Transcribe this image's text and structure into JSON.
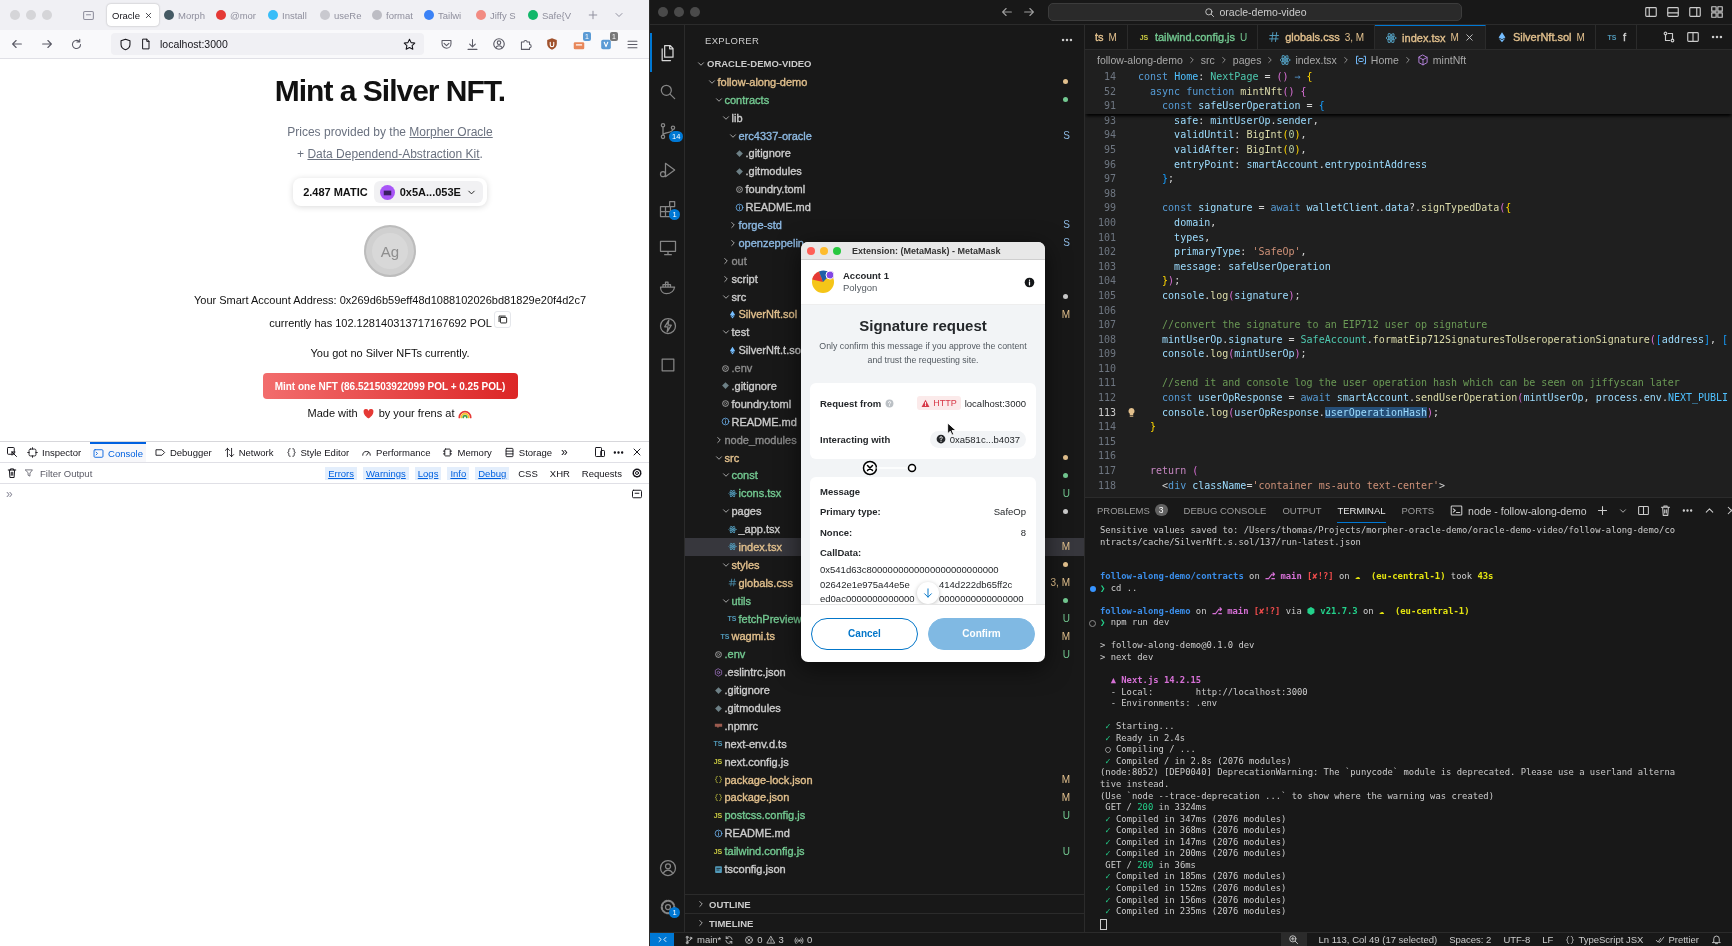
{
  "browser": {
    "tabs": [
      {
        "label": "Oracle",
        "selected": true
      },
      {
        "label": "Morph",
        "selected": false,
        "color": "#455a64"
      },
      {
        "label": "@mor",
        "selected": false,
        "color": "#e53935"
      },
      {
        "label": "Install",
        "selected": false,
        "color": "#38bdf8"
      },
      {
        "label": "useRe",
        "selected": false,
        "color": "#c9c9cf"
      },
      {
        "label": "format",
        "selected": false,
        "color": "#bdbdc4"
      },
      {
        "label": "Tailwi",
        "selected": false,
        "color": "#3b82f6"
      },
      {
        "label": "Jiffy S",
        "selected": false,
        "color": "#f28b82"
      },
      {
        "label": "Safe{V",
        "selected": false,
        "color": "#12b76a"
      }
    ],
    "address": "localhost:3000",
    "extension_badges": [
      "1",
      "1"
    ]
  },
  "page": {
    "title": "Mint a Silver NFT.",
    "credits_line1": {
      "text": "Prices provided by the",
      "link": "Morpher Oracle"
    },
    "credits_line2": {
      "prefix": "+",
      "link": "Data Dependend-Abstraction Kit",
      "suffix": "."
    },
    "wallet": {
      "balance": "2.487 MATIC",
      "account": "0x5A...053E"
    },
    "coin_symbol": "Ag",
    "address_text": "Your Smart Account Address: 0x269d6b59eff48d1088102026bd81829e20f4d2c7",
    "balance_text": "currently has 102.128140313717167692 POL",
    "nft_text": "You got no Silver NFTs currently.",
    "mint_button": "Mint one NFT (86.521503922099 POL + 0.25 POL)",
    "footer": {
      "before": "Made with",
      "after": "by your frens at"
    }
  },
  "devtools": {
    "tabs": [
      {
        "label": "Inspector",
        "kind": "inspector",
        "selected": false
      },
      {
        "label": "Console",
        "kind": "console",
        "selected": true
      },
      {
        "label": "Debugger",
        "kind": "debugger",
        "selected": false
      },
      {
        "label": "Network",
        "kind": "network",
        "selected": false
      },
      {
        "label": "Style Editor",
        "kind": "style",
        "selected": false
      },
      {
        "label": "Performance",
        "kind": "performance",
        "selected": false
      },
      {
        "label": "Memory",
        "kind": "memory",
        "selected": false
      },
      {
        "label": "Storage",
        "kind": "storage",
        "selected": false
      }
    ],
    "overflow": "»",
    "filter_placeholder": "Filter Output",
    "levels": [
      {
        "label": "Errors",
        "on": true
      },
      {
        "label": "Warnings",
        "on": true
      },
      {
        "label": "Logs",
        "on": true
      },
      {
        "label": "Info",
        "on": true
      },
      {
        "label": "Debug",
        "on": true
      },
      {
        "label": "CSS",
        "on": false
      },
      {
        "label": "XHR",
        "on": false
      },
      {
        "label": "Requests",
        "on": false
      }
    ],
    "prompt": "»"
  },
  "titlebar": {
    "search": "oracle-demo-video"
  },
  "activity": {
    "items": [
      {
        "kind": "files",
        "selected": true
      },
      {
        "kind": "search",
        "selected": false
      },
      {
        "kind": "source-control",
        "badge": "14",
        "selected": false
      },
      {
        "kind": "run-debug",
        "selected": false
      },
      {
        "kind": "extensions",
        "badge": "1",
        "selected": false
      },
      {
        "kind": "remote",
        "selected": false
      },
      {
        "kind": "docker",
        "selected": false
      },
      {
        "kind": "bolt",
        "selected": false
      },
      {
        "kind": "square",
        "selected": false
      }
    ],
    "bottom": [
      {
        "kind": "account"
      },
      {
        "kind": "settings",
        "badge": "1"
      }
    ]
  },
  "explorer": {
    "title": "EXPLORER",
    "root": {
      "name": "ORACLE-DEMO-VIDEO",
      "expanded": true
    },
    "tree": [
      {
        "name": "follow-along-demo",
        "kind": "folder",
        "expanded": true,
        "color": "#e2c08d",
        "dot": true,
        "selected": false,
        "children": [
          {
            "name": "contracts",
            "kind": "folder",
            "expanded": true,
            "color": "#73c991",
            "dot": true,
            "selected": false,
            "children": [
              {
                "name": "lib",
                "kind": "folder",
                "expanded": true,
                "color": "#cccccc",
                "dot": false,
                "selected": false,
                "children": [
                  {
                    "name": "erc4337-oracle",
                    "kind": "folder",
                    "expanded": true,
                    "color": "#8db9e2",
                    "dot": false,
                    "status": "S",
                    "selected": false,
                    "children": [
                      {
                        "name": ".gitignore",
                        "kind": "git",
                        "color": "#cccccc",
                        "selected": false
                      },
                      {
                        "name": ".gitmodules",
                        "kind": "git",
                        "color": "#cccccc",
                        "selected": false
                      },
                      {
                        "name": "foundry.toml",
                        "kind": "gear",
                        "color": "#cccccc",
                        "selected": false
                      },
                      {
                        "name": "README.md",
                        "kind": "info",
                        "color": "#cccccc",
                        "selected": false
                      }
                    ]
                  },
                  {
                    "name": "forge-std",
                    "kind": "folder",
                    "expanded": false,
                    "color": "#8db9e2",
                    "dot": false,
                    "status": "S",
                    "selected": false
                  },
                  {
                    "name": "openzeppelin",
                    "kind": "folder",
                    "expanded": false,
                    "color": "#8db9e2",
                    "dot": false,
                    "status": "S",
                    "selected": false
                  }
                ]
              },
              {
                "name": "out",
                "kind": "folder",
                "expanded": false,
                "color": "#8c8c8c",
                "dot": false,
                "selected": false
              },
              {
                "name": "script",
                "kind": "folder",
                "expanded": false,
                "color": "#cccccc",
                "dot": false,
                "selected": false
              },
              {
                "name": "src",
                "kind": "folder",
                "expanded": true,
                "color": "#cccccc",
                "dot": true,
                "selected": false,
                "children": [
                  {
                    "name": "SilverNft.sol",
                    "kind": "eth",
                    "color": "#e2c08d",
                    "status": "M",
                    "selected": false
                  }
                ]
              },
              {
                "name": "test",
                "kind": "folder",
                "expanded": true,
                "color": "#cccccc",
                "dot": false,
                "selected": false,
                "children": [
                  {
                    "name": "SilverNft.t.so",
                    "kind": "eth",
                    "color": "#cccccc",
                    "selected": false
                  }
                ]
              },
              {
                "name": ".env",
                "kind": "gear",
                "color": "#8c8c8c",
                "selected": false
              },
              {
                "name": ".gitignore",
                "kind": "git",
                "color": "#cccccc",
                "selected": false
              },
              {
                "name": "foundry.toml",
                "kind": "gear",
                "color": "#cccccc",
                "selected": false
              },
              {
                "name": "README.md",
                "kind": "info",
                "color": "#cccccc",
                "selected": false
              }
            ]
          },
          {
            "name": "node_modules",
            "kind": "folder",
            "expanded": false,
            "color": "#8c8c8c",
            "dot": false,
            "selected": false
          },
          {
            "name": "src",
            "kind": "folder",
            "expanded": true,
            "color": "#e2c08d",
            "dot": true,
            "selected": false,
            "children": [
              {
                "name": "const",
                "kind": "folder",
                "expanded": true,
                "color": "#73c991",
                "dot": true,
                "selected": false,
                "children": [
                  {
                    "name": "icons.tsx",
                    "kind": "atom",
                    "color": "#73c991",
                    "status": "U",
                    "selected": false
                  }
                ]
              },
              {
                "name": "pages",
                "kind": "folder",
                "expanded": true,
                "color": "#cccccc",
                "dot": true,
                "selected": false,
                "children": [
                  {
                    "name": "_app.tsx",
                    "kind": "atom",
                    "color": "#cccccc",
                    "selected": false
                  },
                  {
                    "name": "index.tsx",
                    "kind": "atom",
                    "color": "#e2c08d",
                    "status": "M",
                    "selected": true
                  }
                ]
              },
              {
                "name": "styles",
                "kind": "folder",
                "expanded": true,
                "color": "#e2c08d",
                "dot": true,
                "selected": false,
                "children": [
                  {
                    "name": "globals.css",
                    "kind": "hash",
                    "color": "#e2c08d",
                    "status": "3, M",
                    "selected": false
                  }
                ]
              },
              {
                "name": "utils",
                "kind": "folder",
                "expanded": true,
                "color": "#73c991",
                "dot": true,
                "selected": false,
                "children": [
                  {
                    "name": "fetchPreview",
                    "kind": "ts",
                    "icon_text": "TS",
                    "color": "#73c991",
                    "status": "U",
                    "selected": false
                  }
                ]
              },
              {
                "name": "wagmi.ts",
                "kind": "ts",
                "icon_text": "TS",
                "color": "#e2c08d",
                "status": "M",
                "selected": false
              }
            ]
          },
          {
            "name": ".env",
            "kind": "gear",
            "color": "#73c991",
            "status": "U",
            "selected": false
          },
          {
            "name": ".eslintrc.json",
            "kind": "eslint",
            "color": "#cccccc",
            "selected": false
          },
          {
            "name": ".gitignore",
            "kind": "git",
            "color": "#cccccc",
            "selected": false
          },
          {
            "name": ".gitmodules",
            "kind": "git",
            "color": "#cccccc",
            "selected": false
          },
          {
            "name": ".npmrc",
            "kind": "npm",
            "color": "#cccccc",
            "selected": false
          },
          {
            "name": "next-env.d.ts",
            "kind": "ts",
            "icon_text": "TS",
            "color": "#cccccc",
            "selected": false
          },
          {
            "name": "next.config.js",
            "kind": "js",
            "icon_text": "JS",
            "color": "#cccccc",
            "selected": false
          },
          {
            "name": "package-lock.json",
            "kind": "braces",
            "color": "#e2c08d",
            "status": "M",
            "selected": false
          },
          {
            "name": "package.json",
            "kind": "braces",
            "color": "#e2c08d",
            "status": "M",
            "selected": false
          },
          {
            "name": "postcss.config.js",
            "kind": "js",
            "icon_text": "JS",
            "color": "#73c991",
            "status": "U",
            "selected": false
          },
          {
            "name": "README.md",
            "kind": "info",
            "color": "#cccccc",
            "selected": false
          },
          {
            "name": "tailwind.config.js",
            "kind": "js",
            "icon_text": "JS",
            "color": "#73c991",
            "status": "U",
            "selected": false
          },
          {
            "name": "tsconfig.json",
            "kind": "tsconfig",
            "color": "#cccccc",
            "selected": false
          }
        ]
      }
    ],
    "sections": [
      {
        "label": "OUTLINE",
        "expanded": false
      },
      {
        "label": "TIMELINE",
        "expanded": false
      }
    ]
  },
  "editor": {
    "tabs": [
      {
        "label": "ts",
        "status": "M",
        "color": "#e2c08d",
        "selected": false
      },
      {
        "label": "tailwind.config.js",
        "status": "U",
        "color": "#73c991",
        "kind": "js",
        "icon_text": "JS",
        "selected": false
      },
      {
        "label": "globals.css",
        "status": "3, M",
        "color": "#e2c08d",
        "kind": "hash",
        "selected": false
      },
      {
        "label": "index.tsx",
        "status": "M",
        "color": "#e2c08d",
        "kind": "atom",
        "selected": true
      },
      {
        "label": "SilverNft.sol",
        "status": "M",
        "color": "#e2c08d",
        "kind": "eth",
        "selected": false
      },
      {
        "label": "f",
        "color": "#cccccc",
        "kind": "ts",
        "icon_text": "TS",
        "selected": false
      }
    ],
    "breadcrumb": [
      {
        "label": "follow-along-demo"
      },
      {
        "label": "src"
      },
      {
        "label": "pages"
      },
      {
        "label": "index.tsx",
        "kind": "atom"
      },
      {
        "label": "Home",
        "kind": "variable"
      },
      {
        "label": "mintNft",
        "kind": "cube"
      }
    ],
    "sticky_lines": [
      {
        "number": "14",
        "current": false,
        "segments": [
          {
            "kind": "kw",
            "text": "const "
          },
          {
            "kind": "const",
            "text": "Home"
          },
          {
            "kind": "pun",
            "text": ": "
          },
          {
            "kind": "type",
            "text": "NextPage"
          },
          {
            "kind": "pun",
            "text": " = "
          },
          {
            "kind": "br2",
            "text": "()"
          },
          {
            "kind": "kw",
            "text": " ⇒ "
          },
          {
            "kind": "br1",
            "text": "{"
          }
        ]
      },
      {
        "number": "52",
        "current": false,
        "segments": [
          {
            "kind": "kw",
            "text": "  async function "
          },
          {
            "kind": "fn",
            "text": "mintNft"
          },
          {
            "kind": "br2",
            "text": "()"
          },
          {
            "kind": "br2",
            "text": " {"
          }
        ]
      },
      {
        "number": "91",
        "current": false,
        "segments": [
          {
            "kind": "kw",
            "text": "    const "
          },
          {
            "kind": "var",
            "text": "safeUserOperation"
          },
          {
            "kind": "pun",
            "text": " = "
          },
          {
            "kind": "br3",
            "text": "{"
          }
        ]
      }
    ],
    "lines": [
      {
        "number": "93",
        "current": false,
        "segments": [
          {
            "kind": "var",
            "text": "      safe"
          },
          {
            "kind": "pun",
            "text": ": "
          },
          {
            "kind": "var",
            "text": "mintUserOp"
          },
          {
            "kind": "pun",
            "text": "."
          },
          {
            "kind": "var",
            "text": "sender"
          },
          {
            "kind": "pun",
            "text": ","
          }
        ]
      },
      {
        "number": "94",
        "current": false,
        "segments": [
          {
            "kind": "var",
            "text": "      validUntil"
          },
          {
            "kind": "pun",
            "text": ": "
          },
          {
            "kind": "fn",
            "text": "BigInt"
          },
          {
            "kind": "br1",
            "text": "("
          },
          {
            "kind": "num",
            "text": "0"
          },
          {
            "kind": "br1",
            "text": ")"
          },
          {
            "kind": "pun",
            "text": ","
          }
        ]
      },
      {
        "number": "95",
        "current": false,
        "segments": [
          {
            "kind": "var",
            "text": "      validAfter"
          },
          {
            "kind": "pun",
            "text": ": "
          },
          {
            "kind": "fn",
            "text": "BigInt"
          },
          {
            "kind": "br1",
            "text": "("
          },
          {
            "kind": "num",
            "text": "0"
          },
          {
            "kind": "br1",
            "text": ")"
          },
          {
            "kind": "pun",
            "text": ","
          }
        ]
      },
      {
        "number": "96",
        "current": false,
        "segments": [
          {
            "kind": "var",
            "text": "      entryPoint"
          },
          {
            "kind": "pun",
            "text": ": "
          },
          {
            "kind": "var",
            "text": "smartAccount"
          },
          {
            "kind": "pun",
            "text": "."
          },
          {
            "kind": "var",
            "text": "entrypointAddress"
          }
        ]
      },
      {
        "number": "97",
        "current": false,
        "segments": [
          {
            "kind": "br3",
            "text": "    }"
          },
          {
            "kind": "pun",
            "text": ";"
          }
        ]
      },
      {
        "number": "98",
        "current": false
      },
      {
        "number": "99",
        "current": false,
        "segments": [
          {
            "kind": "kw",
            "text": "    const "
          },
          {
            "kind": "var",
            "text": "signature"
          },
          {
            "kind": "pun",
            "text": " = "
          },
          {
            "kind": "kw",
            "text": "await "
          },
          {
            "kind": "var",
            "text": "walletClient"
          },
          {
            "kind": "pun",
            "text": "."
          },
          {
            "kind": "var",
            "text": "data"
          },
          {
            "kind": "pun",
            "text": "?."
          },
          {
            "kind": "fn",
            "text": "signTypedData"
          },
          {
            "kind": "br2",
            "text": "("
          },
          {
            "kind": "br1",
            "text": "{"
          }
        ]
      },
      {
        "number": "100",
        "current": false,
        "segments": [
          {
            "kind": "var",
            "text": "      domain"
          },
          {
            "kind": "pun",
            "text": ","
          }
        ]
      },
      {
        "number": "101",
        "current": false,
        "segments": [
          {
            "kind": "var",
            "text": "      types"
          },
          {
            "kind": "pun",
            "text": ","
          }
        ]
      },
      {
        "number": "102",
        "current": false,
        "segments": [
          {
            "kind": "var",
            "text": "      primaryType"
          },
          {
            "kind": "pun",
            "text": ": "
          },
          {
            "kind": "str",
            "text": "'SafeOp'"
          },
          {
            "kind": "pun",
            "text": ","
          }
        ]
      },
      {
        "number": "103",
        "current": false,
        "segments": [
          {
            "kind": "var",
            "text": "      message"
          },
          {
            "kind": "pun",
            "text": ": "
          },
          {
            "kind": "var",
            "text": "safeUserOperation"
          }
        ]
      },
      {
        "number": "104",
        "current": false,
        "segments": [
          {
            "kind": "br1",
            "text": "    }"
          },
          {
            "kind": "br2",
            "text": ")"
          },
          {
            "kind": "pun",
            "text": ";"
          }
        ]
      },
      {
        "number": "105",
        "current": false,
        "segments": [
          {
            "kind": "var",
            "text": "    console"
          },
          {
            "kind": "pun",
            "text": "."
          },
          {
            "kind": "fn",
            "text": "log"
          },
          {
            "kind": "br2",
            "text": "("
          },
          {
            "kind": "var",
            "text": "signature"
          },
          {
            "kind": "br2",
            "text": ")"
          },
          {
            "kind": "pun",
            "text": ";"
          }
        ]
      },
      {
        "number": "106",
        "current": false
      },
      {
        "number": "107",
        "current": false,
        "segments": [
          {
            "kind": "com",
            "text": "    //convert the signature to an EIP712 user op signature"
          }
        ]
      },
      {
        "number": "108",
        "current": false,
        "segments": [
          {
            "kind": "var",
            "text": "    mintUserOp"
          },
          {
            "kind": "pun",
            "text": "."
          },
          {
            "kind": "var",
            "text": "signature"
          },
          {
            "kind": "pun",
            "text": " = "
          },
          {
            "kind": "type",
            "text": "SafeAccount"
          },
          {
            "kind": "pun",
            "text": "."
          },
          {
            "kind": "fn",
            "text": "formatEip712SignaturesToUseroperationSignature"
          },
          {
            "kind": "br2",
            "text": "("
          },
          {
            "kind": "br3",
            "text": "["
          },
          {
            "kind": "var",
            "text": "address"
          },
          {
            "kind": "br3",
            "text": "]"
          },
          {
            "kind": "pun",
            "text": ", "
          },
          {
            "kind": "br3",
            "text": "["
          }
        ]
      },
      {
        "number": "109",
        "current": false,
        "segments": [
          {
            "kind": "var",
            "text": "    console"
          },
          {
            "kind": "pun",
            "text": "."
          },
          {
            "kind": "fn",
            "text": "log"
          },
          {
            "kind": "br2",
            "text": "("
          },
          {
            "kind": "var",
            "text": "mintUserOp"
          },
          {
            "kind": "br2",
            "text": ")"
          },
          {
            "kind": "pun",
            "text": ";"
          }
        ]
      },
      {
        "number": "110",
        "current": false
      },
      {
        "number": "111",
        "current": false,
        "segments": [
          {
            "kind": "com",
            "text": "    //send it and console log the user operation hash which can be seen on jiffyscan later"
          }
        ]
      },
      {
        "number": "112",
        "current": false,
        "segments": [
          {
            "kind": "kw",
            "text": "    const "
          },
          {
            "kind": "var",
            "text": "userOpResponse"
          },
          {
            "kind": "pun",
            "text": " = "
          },
          {
            "kind": "kw",
            "text": "await "
          },
          {
            "kind": "var",
            "text": "smartAccount"
          },
          {
            "kind": "pun",
            "text": "."
          },
          {
            "kind": "fn",
            "text": "sendUserOperation"
          },
          {
            "kind": "br2",
            "text": "("
          },
          {
            "kind": "var",
            "text": "mintUserOp"
          },
          {
            "kind": "pun",
            "text": ", "
          },
          {
            "kind": "var",
            "text": "process"
          },
          {
            "kind": "pun",
            "text": "."
          },
          {
            "kind": "var",
            "text": "env"
          },
          {
            "kind": "pun",
            "text": "."
          },
          {
            "kind": "const",
            "text": "NEXT_PUBLI"
          }
        ]
      },
      {
        "number": "113",
        "current": true,
        "segments": [
          {
            "kind": "var",
            "text": "    console"
          },
          {
            "kind": "pun",
            "text": "."
          },
          {
            "kind": "fn",
            "text": "log"
          },
          {
            "kind": "br2",
            "text": "("
          },
          {
            "kind": "var",
            "text": "userOpResponse"
          },
          {
            "kind": "pun",
            "text": "."
          },
          {
            "kind": "sel",
            "text": "userOperationHash"
          },
          {
            "kind": "br2",
            "text": ")"
          },
          {
            "kind": "pun",
            "text": ";"
          }
        ]
      },
      {
        "number": "114",
        "current": false,
        "segments": [
          {
            "kind": "br1",
            "text": "  }"
          }
        ]
      },
      {
        "number": "115",
        "current": false
      },
      {
        "number": "116",
        "current": false
      },
      {
        "number": "117",
        "current": false,
        "segments": [
          {
            "kind": "ctl",
            "text": "  return "
          },
          {
            "kind": "br2",
            "text": "("
          }
        ]
      },
      {
        "number": "118",
        "current": false,
        "segments": [
          {
            "kind": "pun",
            "text": "    <"
          },
          {
            "kind": "tag",
            "text": "div"
          },
          {
            "kind": "var",
            "text": " className"
          },
          {
            "kind": "pun",
            "text": "="
          },
          {
            "kind": "str",
            "text": "'container ms-auto text-center'"
          },
          {
            "kind": "pun",
            "text": ">"
          }
        ]
      }
    ]
  },
  "panel": {
    "tabs": [
      {
        "label": "PROBLEMS",
        "badge": "3",
        "selected": false
      },
      {
        "label": "DEBUG CONSOLE",
        "selected": false
      },
      {
        "label": "OUTPUT",
        "selected": false
      },
      {
        "label": "TERMINAL",
        "selected": true
      },
      {
        "label": "PORTS",
        "selected": false
      }
    ],
    "terminal_name": "node - follow-along-demo",
    "lines": [
      {
        "kind": "plain",
        "text": "Sensitive values saved to: /Users/thomas/Projects/morpher-oracle-demo/oracle-demo-video/follow-along-demo/co"
      },
      {
        "kind": "plain",
        "text": "ntracts/cache/SilverNft.s.sol/137/run-latest.json"
      },
      {
        "kind": "blank"
      },
      {
        "kind": "blank"
      },
      {
        "kind": "styled",
        "segments": [
          {
            "kind": "path",
            "text": "follow-along-demo/contracts"
          },
          {
            "kind": "text",
            "text": " on "
          },
          {
            "kind": "branch",
            "text": "⎇ main"
          },
          {
            "kind": "status",
            "text": " [✘!?]"
          },
          {
            "kind": "text",
            "text": " on "
          },
          {
            "kind": "region",
            "text": "☁  (eu-central-1)"
          },
          {
            "kind": "text",
            "text": " took "
          },
          {
            "kind": "region",
            "text": "43s"
          }
        ]
      },
      {
        "kind": "command",
        "done": true,
        "segments": [
          {
            "kind": "prompt",
            "text": "❯"
          },
          {
            "kind": "text",
            "text": " cd .."
          }
        ]
      },
      {
        "kind": "blank"
      },
      {
        "kind": "styled",
        "segments": [
          {
            "kind": "path",
            "text": "follow-along-demo"
          },
          {
            "kind": "text",
            "text": " on "
          },
          {
            "kind": "branch",
            "text": "⎇ main"
          },
          {
            "kind": "status",
            "text": " [✘!?]"
          },
          {
            "kind": "text",
            "text": " via "
          },
          {
            "kind": "version",
            "text": "⬢ v21.7.3"
          },
          {
            "kind": "text",
            "text": " on "
          },
          {
            "kind": "region",
            "text": "☁  (eu-central-1)"
          }
        ]
      },
      {
        "kind": "command",
        "done": false,
        "segments": [
          {
            "kind": "prompt",
            "text": "❯"
          },
          {
            "kind": "text",
            "text": " npm run dev"
          }
        ]
      },
      {
        "kind": "blank"
      },
      {
        "kind": "plain",
        "text": "> follow-along-demo@0.1.0 dev"
      },
      {
        "kind": "plain",
        "text": "> next dev"
      },
      {
        "kind": "blank"
      },
      {
        "kind": "styled",
        "segments": [
          {
            "kind": "next",
            "text": "  ▲ Next.js 14.2.15"
          }
        ]
      },
      {
        "kind": "plain",
        "text": "  - Local:        http://localhost:3000"
      },
      {
        "kind": "plain",
        "text": "  - Environments: .env"
      },
      {
        "kind": "blank"
      },
      {
        "kind": "styled",
        "segments": [
          {
            "kind": "ok",
            "text": " ✓"
          },
          {
            "kind": "text",
            "text": " Starting..."
          }
        ]
      },
      {
        "kind": "styled",
        "segments": [
          {
            "kind": "ok",
            "text": " ✓"
          },
          {
            "kind": "text",
            "text": " Ready in 2.4s"
          }
        ]
      },
      {
        "kind": "plain",
        "text": " ○ Compiling / ..."
      },
      {
        "kind": "styled",
        "segments": [
          {
            "kind": "ok",
            "text": " ✓"
          },
          {
            "kind": "text",
            "text": " Compiled / in 2.8s (2076 modules)"
          }
        ]
      },
      {
        "kind": "plain",
        "text": "(node:8052) [DEP0040] DeprecationWarning: The `punycode` module is deprecated. Please use a userland alterna"
      },
      {
        "kind": "plain",
        "text": "tive instead."
      },
      {
        "kind": "plain",
        "text": "(Use `node --trace-deprecation ...` to show where the warning was created)"
      },
      {
        "kind": "styled",
        "segments": [
          {
            "kind": "text",
            "text": " GET / "
          },
          {
            "kind": "num",
            "text": "200"
          },
          {
            "kind": "text",
            "text": " in 3324ms"
          }
        ]
      },
      {
        "kind": "styled",
        "segments": [
          {
            "kind": "ok",
            "text": " ✓"
          },
          {
            "kind": "text",
            "text": " Compiled in 347ms (2076 modules)"
          }
        ]
      },
      {
        "kind": "styled",
        "segments": [
          {
            "kind": "ok",
            "text": " ✓"
          },
          {
            "kind": "text",
            "text": " Compiled in 368ms (2076 modules)"
          }
        ]
      },
      {
        "kind": "styled",
        "segments": [
          {
            "kind": "ok",
            "text": " ✓"
          },
          {
            "kind": "text",
            "text": " Compiled in 147ms (2076 modules)"
          }
        ]
      },
      {
        "kind": "styled",
        "segments": [
          {
            "kind": "ok",
            "text": " ✓"
          },
          {
            "kind": "text",
            "text": " Compiled in 200ms (2076 modules)"
          }
        ]
      },
      {
        "kind": "styled",
        "segments": [
          {
            "kind": "text",
            "text": " GET / "
          },
          {
            "kind": "num",
            "text": "200"
          },
          {
            "kind": "text",
            "text": " in 36ms"
          }
        ]
      },
      {
        "kind": "styled",
        "segments": [
          {
            "kind": "ok",
            "text": " ✓"
          },
          {
            "kind": "text",
            "text": " Compiled in 185ms (2076 modules)"
          }
        ]
      },
      {
        "kind": "styled",
        "segments": [
          {
            "kind": "ok",
            "text": " ✓"
          },
          {
            "kind": "text",
            "text": " Compiled in 152ms (2076 modules)"
          }
        ]
      },
      {
        "kind": "styled",
        "segments": [
          {
            "kind": "ok",
            "text": " ✓"
          },
          {
            "kind": "text",
            "text": " Compiled in 156ms (2076 modules)"
          }
        ]
      },
      {
        "kind": "styled",
        "segments": [
          {
            "kind": "ok",
            "text": " ✓"
          },
          {
            "kind": "text",
            "text": " Compiled in 235ms (2076 modules)"
          }
        ]
      },
      {
        "kind": "cursor"
      }
    ]
  },
  "status_bar": {
    "branch": "main*",
    "errors": "0",
    "warnings": "3",
    "ports": "0",
    "position": "Ln 113, Col 49 (17 selected)",
    "indent": "Spaces: 2",
    "encoding": "UTF-8",
    "eol": "LF",
    "language": "TypeScript JSX",
    "formatter": "Prettier"
  },
  "metamask": {
    "title": "Extension: (MetaMask) - MetaMask",
    "account": "Account 1",
    "network": "Polygon",
    "heading": "Signature request",
    "description": "Only confirm this message if you approve the content and trust the requesting site.",
    "request_from": {
      "label": "Request from",
      "badge": "HTTP",
      "origin": "localhost:3000"
    },
    "interacting_with": {
      "label": "Interacting with",
      "address": "0xa581c...b4037"
    },
    "message": {
      "title": "Message",
      "fields": [
        {
          "label": "Primary type:",
          "value": "SafeOp"
        },
        {
          "label": "Nonce:",
          "value": "8"
        }
      ],
      "calldata_label": "CallData:",
      "calldata_lines": [
        {
          "start": "0x541d63c8000000000000000000000000"
        },
        {
          "start": "02642e1e975a44e5e",
          "end": "414d222db65ff2c"
        },
        {
          "start": "ed0ac0000000000000",
          "end": "0000000000000000"
        }
      ]
    },
    "buttons": [
      {
        "label": "Cancel",
        "kind": "secondary",
        "disabled": false
      },
      {
        "label": "Confirm",
        "kind": "primary",
        "disabled": true
      }
    ]
  }
}
